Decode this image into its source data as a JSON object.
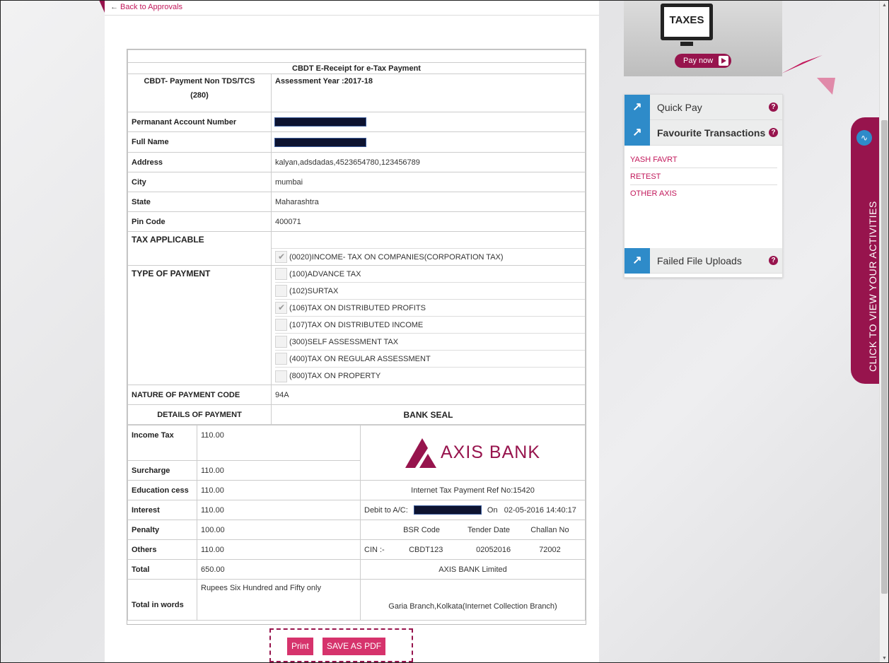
{
  "nav": {
    "back_label": "Back to Approvals"
  },
  "receipt": {
    "title": "CBDT E-Receipt for e-Tax Payment",
    "payment_type_label": "CBDT- Payment Non TDS/TCS",
    "payment_type_code": "(280)",
    "assessment_year": "Assessment Year :2017-18",
    "fields": [
      {
        "label": "Permanant Account Number",
        "value": "",
        "redacted": true
      },
      {
        "label": "Full Name",
        "value": "",
        "redacted": true
      },
      {
        "label": "Address",
        "value": "kalyan,adsdadas,4523654780,123456789"
      },
      {
        "label": "City",
        "value": "mumbai"
      },
      {
        "label": "State",
        "value": "Maharashtra"
      },
      {
        "label": "Pin Code",
        "value": "400071"
      }
    ],
    "tax_applicable_label": "TAX APPLICABLE",
    "tax_applicable_option": {
      "label": "(0020)INCOME- TAX ON COMPANIES(CORPORATION TAX)",
      "checked": true
    },
    "type_of_payment_label": "TYPE OF PAYMENT",
    "payment_options": [
      {
        "label": "(100)ADVANCE TAX",
        "checked": false
      },
      {
        "label": "(102)SURTAX",
        "checked": false
      },
      {
        "label": "(106)TAX ON DISTRIBUTED PROFITS",
        "checked": true
      },
      {
        "label": "(107)TAX ON DISTRIBUTED INCOME",
        "checked": false
      },
      {
        "label": "(300)SELF ASSESSMENT TAX",
        "checked": false
      },
      {
        "label": "(400)TAX ON REGULAR ASSESSMENT",
        "checked": false
      },
      {
        "label": "(800)TAX ON PROPERTY",
        "checked": false
      }
    ],
    "nature_label": "NATURE OF PAYMENT CODE",
    "nature_value": "94A",
    "details_header": "DETAILS OF PAYMENT",
    "bank_seal_header": "BANK SEAL",
    "amounts": [
      {
        "label": "Income Tax",
        "value": "110.00"
      },
      {
        "label": "Surcharge",
        "value": "110.00"
      },
      {
        "label": "Education cess",
        "value": "110.00"
      },
      {
        "label": "Interest",
        "value": "110.00"
      },
      {
        "label": "Penalty",
        "value": "100.00"
      },
      {
        "label": "Others",
        "value": "110.00"
      },
      {
        "label": "Total",
        "value": "650.00"
      }
    ],
    "total_words_label": "Total in words",
    "total_words_value": "Rupees Six Hundred and Fifty only",
    "bank": {
      "logo_text": "AXIS BANK",
      "ref_no": "Internet Tax Payment Ref No:15420",
      "debit_label": "Debit to A/C:",
      "on_label": "On",
      "date_time": "02-05-2016 14:40:17",
      "bsr_header": "BSR Code",
      "tender_header": "Tender Date",
      "challan_header": "Challan No",
      "cin_label": "CIN :-",
      "bsr_code": "CBDT123",
      "tender_date": "02052016",
      "challan_no": "72002",
      "bank_name": "AXIS BANK Limited",
      "branch": "Garia Branch,Kolkata(Internet Collection Branch)"
    }
  },
  "actions": {
    "print_label": "Print",
    "pdf_label": "SAVE AS PDF"
  },
  "promo": {
    "monitor_text": "TAXES",
    "pay_now_label": "Pay now"
  },
  "widget": {
    "quick_pay": "Quick Pay",
    "favourites_title": "Favourite Transactions",
    "favourites": [
      "YASH FAVRT",
      "RETEST",
      "OTHER AXIS"
    ],
    "failed_uploads": "Failed File Uploads"
  },
  "activities_label": "CLICK TO VIEW YOUR ACTIVITIES",
  "colors": {
    "brand": "#97144d",
    "accent_blue": "#2e8bc9",
    "link": "#c2185b"
  }
}
